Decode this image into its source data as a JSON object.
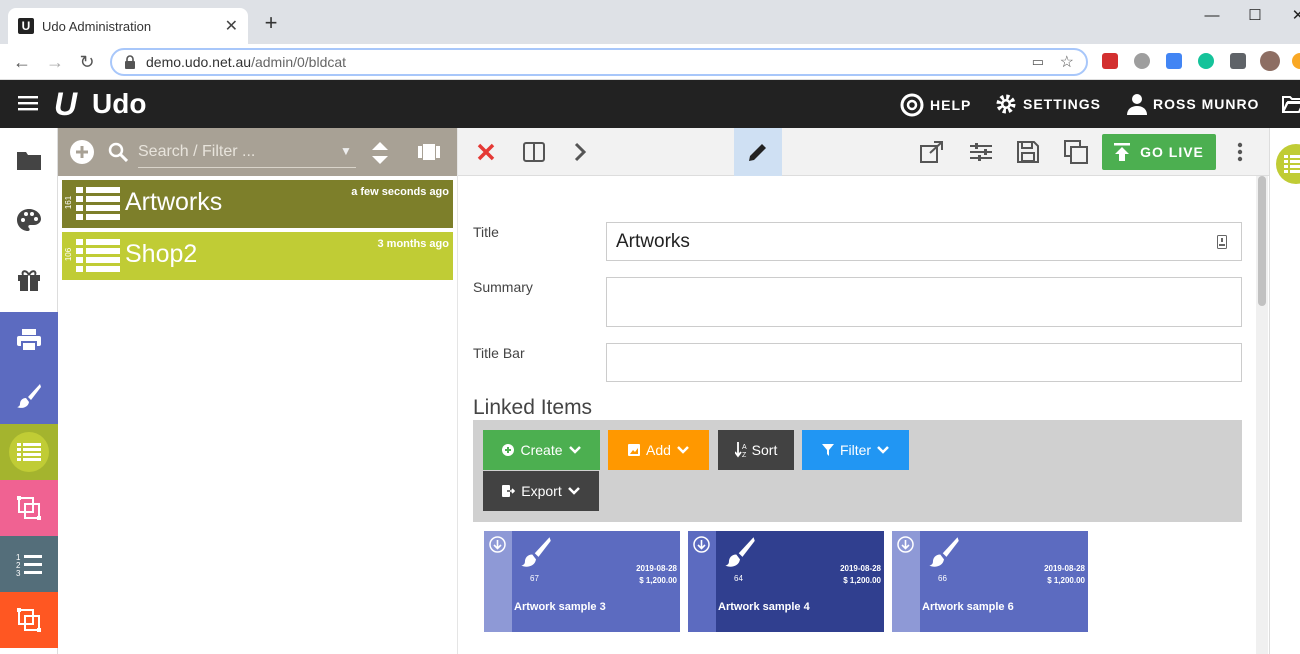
{
  "browser": {
    "tab_title": "Udo Administration",
    "url_host": "demo.udo.net.au",
    "url_path": "/admin/0/bldcat"
  },
  "header": {
    "logo_text": "Udo",
    "help_label": "HELP",
    "settings_label": "SETTINGS",
    "user_label": "ROSS MUNRO"
  },
  "list": {
    "search_placeholder": "Search / Filter ...",
    "items": [
      {
        "count": "161",
        "title": "Artworks",
        "age": "a few seconds ago",
        "color": "#7d7f2a"
      },
      {
        "count": "106",
        "title": "Shop2",
        "age": "3 months ago",
        "color": "#c0cc35"
      }
    ]
  },
  "detail": {
    "go_live_label": "GO LIVE",
    "fields": {
      "title_label": "Title",
      "title_value": "Artworks",
      "summary_label": "Summary",
      "summary_value": "",
      "titlebar_label": "Title Bar",
      "titlebar_value": ""
    },
    "linked_items_heading": "Linked Items",
    "buttons": {
      "create": "Create",
      "add": "Add",
      "sort": "Sort",
      "filter": "Filter",
      "export": "Export"
    },
    "cards": [
      {
        "num": "67",
        "date": "2019-08-28",
        "price": "$ 1,200.00",
        "title": "Artwork sample 3"
      },
      {
        "num": "64",
        "date": "2019-08-28",
        "price": "$ 1,200.00",
        "title": "Artwork sample 4"
      },
      {
        "num": "66",
        "date": "2019-08-28",
        "price": "$ 1,200.00",
        "title": "Artwork sample 6"
      }
    ]
  },
  "colors": {
    "create": "#4caf50",
    "add": "#ff9800",
    "sort": "#424242",
    "filter": "#2196f3",
    "export": "#424242",
    "go_live": "#4caf50",
    "card_default": "#5c6bc0",
    "card_selected": "#303f8f"
  }
}
